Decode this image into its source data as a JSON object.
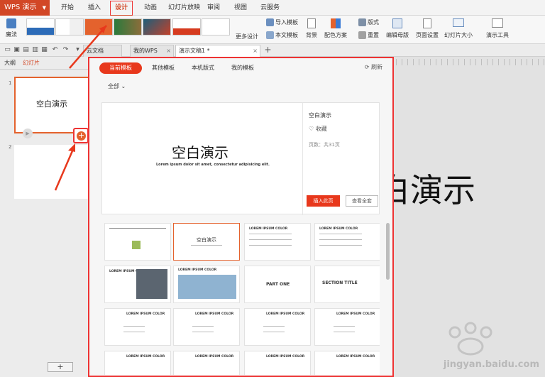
{
  "app": {
    "name": "WPS 演示",
    "accent": "#d24726"
  },
  "menu": [
    "开始",
    "插入",
    "设计",
    "动画",
    "幻灯片放映",
    "审阅",
    "视图",
    "云服务"
  ],
  "menu_active": "设计",
  "ribbon": {
    "magic": "魔法",
    "more_designs": "更多设计",
    "import_template": "导入模板",
    "doc_template": "本文模板",
    "background": "背景",
    "color_scheme": "配色方案",
    "layout": "版式",
    "rearrange": "重置",
    "edit_master": "编辑母版",
    "page_setup": "页面设置",
    "slide_size": "幻灯片大小",
    "present_tools": "演示工具"
  },
  "tabs": [
    {
      "label": "云文档"
    },
    {
      "label": "我的WPS"
    },
    {
      "label": "演示文稿1 *"
    }
  ],
  "left_pane": {
    "tabs": [
      "大纲",
      "幻灯片"
    ],
    "active_tab": "幻灯片",
    "slides": [
      {
        "num": "1",
        "title": "空白演示"
      },
      {
        "num": "2",
        "title": ""
      }
    ]
  },
  "canvas": {
    "title_fragment": "白演示"
  },
  "dialog": {
    "tabs": [
      "当前模板",
      "其他模板",
      "本机版式",
      "我的模板"
    ],
    "active_tab": "当前模板",
    "refresh": "刷新",
    "filter": "全部",
    "preview": {
      "title": "空白演示",
      "subtitle": "Lorem ipsum dolor sit amet, consectetur adipisicing elit.",
      "name": "空白演示",
      "favorite": "收藏",
      "pages": "页数：共31页",
      "insert": "插入此页",
      "view_all": "查看全套"
    },
    "thumbs": [
      {
        "label": ""
      },
      {
        "label": "空白演示"
      },
      {
        "label": "LOREM IPSUM COLOR"
      },
      {
        "label": "LOREM IPSUM COLOR"
      },
      {
        "label": "LOREM IPSUM COLOR"
      },
      {
        "label": "LOREM IPSUM COLOR"
      },
      {
        "label": "PART ONE"
      },
      {
        "label": "SECTION TITLE"
      },
      {
        "label": "LOREM IPSUM COLOR"
      },
      {
        "label": "LOREM IPSUM COLOR"
      },
      {
        "label": "LOREM IPSUM COLOR"
      },
      {
        "label": "LOREM IPSUM COLOR"
      },
      {
        "label": "LOREM IPSUM COLOR"
      },
      {
        "label": "LOREM IPSUM COLOR"
      },
      {
        "label": "LOREM IPSUM COLOR"
      },
      {
        "label": "LOREM IPSUM COLOR"
      }
    ]
  },
  "watermark": "jingyan.baidu.com"
}
